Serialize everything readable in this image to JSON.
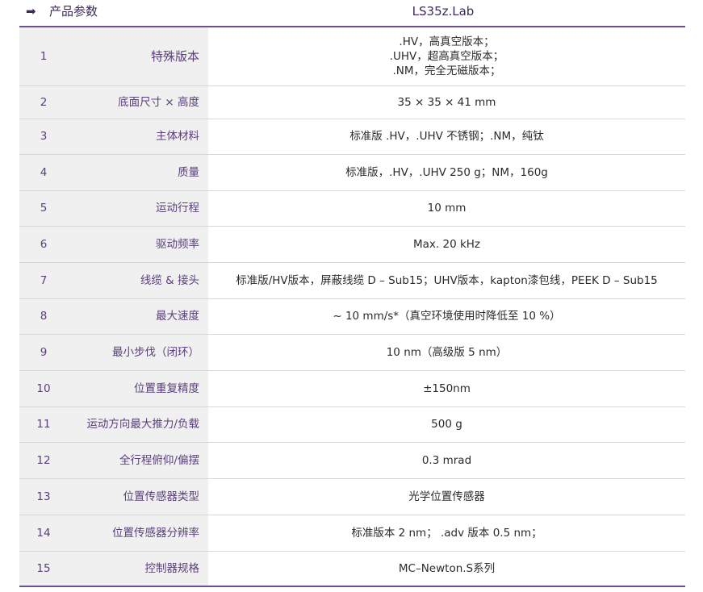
{
  "header": {
    "arrow_icon": "➡",
    "title": "产品参数",
    "model": "LS35z.Lab"
  },
  "rows": [
    {
      "num": "1",
      "label": "特殊版本",
      "value": [
        ".HV，高真空版本；",
        ".UHV，超高真空版本；",
        ".NM，完全无磁版本；"
      ]
    },
    {
      "num": "2",
      "label": "底面尺寸 × 高度",
      "value": [
        "35 × 35 × 41 mm"
      ]
    },
    {
      "num": "3",
      "label": "主体材料",
      "value": [
        "标准版 .HV，.UHV 不锈钢；.NM，纯钛"
      ]
    },
    {
      "num": "4",
      "label": "质量",
      "value": [
        "标准版，.HV，.UHV 250 g；NM，160g"
      ]
    },
    {
      "num": "5",
      "label": "运动行程",
      "value": [
        "10 mm"
      ]
    },
    {
      "num": "6",
      "label": "驱动频率",
      "value": [
        "Max. 20 kHz"
      ]
    },
    {
      "num": "7",
      "label": "线缆 & 接头",
      "value": [
        "标准版/HV版本，屏蔽线缆 D – Sub15；UHV版本，kapton漆包线，PEEK D – Sub15"
      ]
    },
    {
      "num": "8",
      "label": "最大速度",
      "value": [
        "~ 10 mm/s*（真空环境使用时降低至 10 %）"
      ]
    },
    {
      "num": "9",
      "label": "最小步伐（闭环）",
      "value": [
        "10 nm（高级版 5 nm）"
      ]
    },
    {
      "num": "10",
      "label": "位置重复精度",
      "value": [
        "±150nm"
      ]
    },
    {
      "num": "11",
      "label": "运动方向最大推力/负载",
      "value": [
        "500 g"
      ]
    },
    {
      "num": "12",
      "label": "全行程俯仰/偏摆",
      "value": [
        "0.3 mrad"
      ]
    },
    {
      "num": "13",
      "label": "位置传感器类型",
      "value": [
        "光学位置传感器"
      ]
    },
    {
      "num": "14",
      "label": "位置传感器分辨率",
      "value": [
        "标准版本  2 nm；  .adv 版本 0.5 nm；"
      ]
    },
    {
      "num": "15",
      "label": "控制器规格",
      "value": [
        "MC–Newton.S系列"
      ]
    }
  ]
}
